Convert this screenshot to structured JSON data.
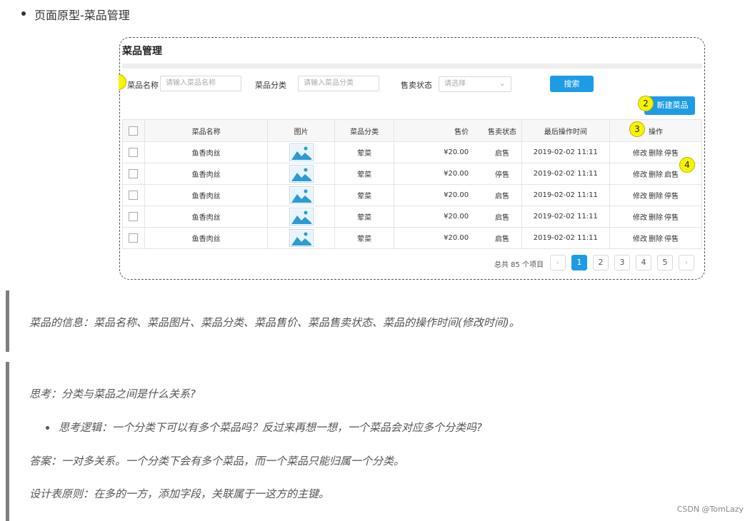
{
  "heading": "页面原型-菜品管理",
  "prototype": {
    "title": "菜品管理",
    "filters": {
      "name_label": "菜品名称",
      "name_placeholder": "请输入菜品名称",
      "category_label": "菜品分类",
      "category_placeholder": "请输入菜品分类",
      "status_label": "售卖状态",
      "status_placeholder": "请选择",
      "search_label": "搜索"
    },
    "new_button": "新建菜品",
    "markers": [
      "2",
      "3",
      "4"
    ],
    "table": {
      "headers": [
        "菜品名称",
        "图片",
        "菜品分类",
        "售价",
        "售卖状态",
        "最后操作时间",
        "操作"
      ],
      "rows": [
        {
          "name": "鱼香肉丝",
          "category": "荤菜",
          "price": "¥20.00",
          "status": "启售",
          "time": "2019-02-02 11:11",
          "op1": "修改",
          "op2": "删除",
          "op3": "停售"
        },
        {
          "name": "鱼香肉丝",
          "category": "荤菜",
          "price": "¥20.00",
          "status": "停售",
          "time": "2019-02-02 11:11",
          "op1": "修改",
          "op2": "删除",
          "op3": "启售"
        },
        {
          "name": "鱼香肉丝",
          "category": "荤菜",
          "price": "¥20.00",
          "status": "启售",
          "time": "2019-02-02 11:11",
          "op1": "修改",
          "op2": "删除",
          "op3": "停售"
        },
        {
          "name": "鱼香肉丝",
          "category": "荤菜",
          "price": "¥20.00",
          "status": "启售",
          "time": "2019-02-02 11:11",
          "op1": "修改",
          "op2": "删除",
          "op3": "停售"
        },
        {
          "name": "鱼香肉丝",
          "category": "荤菜",
          "price": "¥20.00",
          "status": "启售",
          "time": "2019-02-02 11:11",
          "op1": "修改",
          "op2": "删除",
          "op3": "停售"
        }
      ]
    },
    "pagination": {
      "total": "总共 85 个项目",
      "prev": "‹",
      "pages": [
        "1",
        "2",
        "3",
        "4",
        "5"
      ],
      "next": "›"
    }
  },
  "quotes": {
    "info": "菜品的信息：菜品名称、菜品图片、菜品分类、菜品售价、菜品售卖状态、菜品的操作时间(修改时间)。",
    "think": "思考：分类与菜品之间是什么关系?",
    "logic": "思考逻辑：一个分类下可以有多个菜品吗？反过来再想一想，一个菜品会对应多个分类吗?",
    "answer": "答案：一对多关系。一个分类下会有多个菜品，而一个菜品只能归属一个分类。",
    "principle": "设计表原则：在多的一方，添加字段，关联属于一这方的主键。"
  },
  "watermark": "CSDN @TomLazy",
  "colors": {
    "accent": "#1e9be5",
    "marker": "#f8f400",
    "quote_bar": "#7f7f7f"
  }
}
